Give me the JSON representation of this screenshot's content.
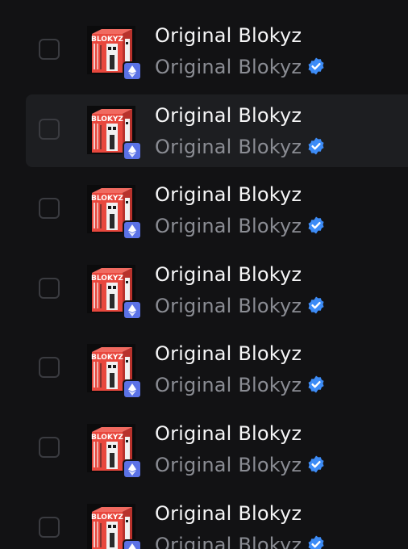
{
  "nft_list": {
    "items": [
      {
        "name": "Original Blokyz",
        "collection": "Original Blokyz",
        "thumb_text": "BLOKYZ",
        "verified": true,
        "chain": "ethereum",
        "selected": false
      },
      {
        "name": "Original Blokyz",
        "collection": "Original Blokyz",
        "thumb_text": "BLOKYZ",
        "verified": true,
        "chain": "ethereum",
        "selected": false,
        "hovered": true
      },
      {
        "name": "Original Blokyz",
        "collection": "Original Blokyz",
        "thumb_text": "BLOKYZ",
        "verified": true,
        "chain": "ethereum",
        "selected": false
      },
      {
        "name": "Original Blokyz",
        "collection": "Original Blokyz",
        "thumb_text": "BLOKYZ",
        "verified": true,
        "chain": "ethereum",
        "selected": false
      },
      {
        "name": "Original Blokyz",
        "collection": "Original Blokyz",
        "thumb_text": "BLOKYZ",
        "verified": true,
        "chain": "ethereum",
        "selected": false
      },
      {
        "name": "Original Blokyz",
        "collection": "Original Blokyz",
        "thumb_text": "BLOKYZ",
        "verified": true,
        "chain": "ethereum",
        "selected": false
      },
      {
        "name": "Original Blokyz",
        "collection": "Original Blokyz",
        "thumb_text": "BLOKYZ",
        "verified": true,
        "chain": "ethereum",
        "selected": false
      }
    ]
  },
  "colors": {
    "background": "#121214",
    "hover_row": "#1d1e21",
    "verified": "#3d8cf7",
    "chain_badge": "#5b72e6",
    "thumb_red": "#e8483e"
  }
}
